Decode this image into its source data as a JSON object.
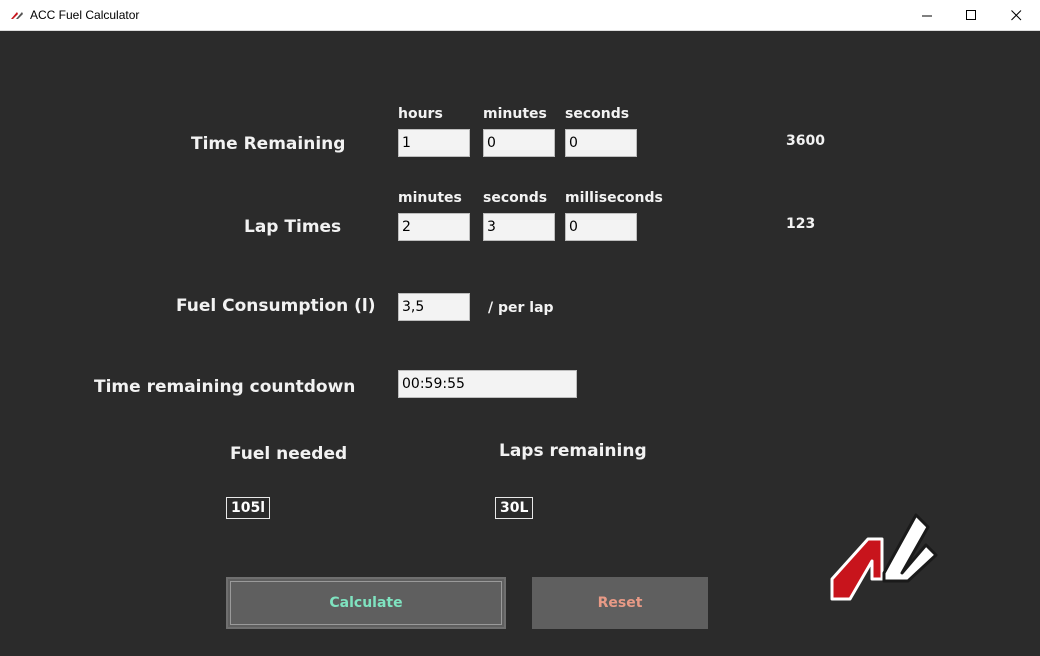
{
  "window": {
    "title": "ACC Fuel Calculator"
  },
  "time_remaining": {
    "label": "Time Remaining",
    "units": [
      "hours",
      "minutes",
      "seconds"
    ],
    "values": [
      "1",
      "0",
      "0"
    ],
    "total": "3600"
  },
  "lap_times": {
    "label": "Lap Times",
    "units": [
      "minutes",
      "seconds",
      "milliseconds"
    ],
    "values": [
      "2",
      "3",
      "0"
    ],
    "total": "123"
  },
  "fuel_consumption": {
    "label": "Fuel Consumption (l)",
    "value": "3,5",
    "unit": "/ per lap"
  },
  "countdown": {
    "label": "Time remaining countdown",
    "value": "00:59:55"
  },
  "results": {
    "fuel_needed_label": "Fuel needed",
    "fuel_needed_value": "105l",
    "laps_remaining_label": "Laps remaining",
    "laps_remaining_value": "30L"
  },
  "buttons": {
    "calculate": "Calculate",
    "reset": "Reset"
  },
  "colors": {
    "background": "#2b2b2b",
    "calculate_text": "#7fe3c0",
    "reset_text": "#e89a86",
    "logo_red": "#c8141c"
  },
  "icons": {
    "app": "acc-logo-icon",
    "logo": "acc-logo"
  }
}
